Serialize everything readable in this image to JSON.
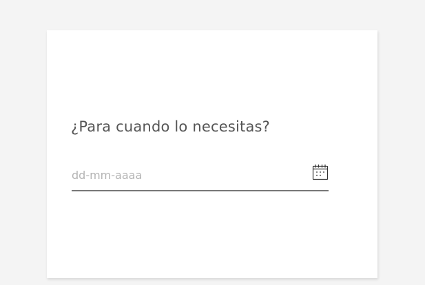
{
  "form": {
    "question": "¿Para cuando lo necesitas?",
    "date_value": "",
    "date_placeholder": "dd-mm-aaaa",
    "calendar_icon": "calendar-icon"
  },
  "colors": {
    "page_background": "#f4f4f4",
    "card_background": "#ffffff",
    "question_text": "#555555",
    "placeholder_text": "#b3b3b3",
    "underline": "#777777",
    "icon": "#333333"
  }
}
